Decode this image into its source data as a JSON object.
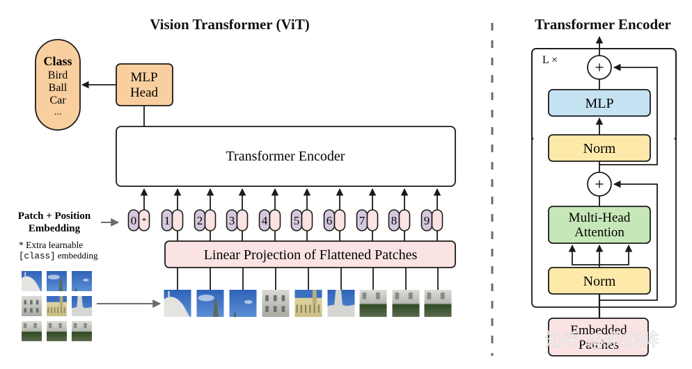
{
  "vit": {
    "title": "Vision Transformer (ViT)",
    "class_box": {
      "heading": "Class",
      "items": [
        "Bird",
        "Ball",
        "Car",
        "..."
      ]
    },
    "mlp_head": {
      "line1": "MLP",
      "line2": "Head"
    },
    "transformer_encoder_label": "Transformer Encoder",
    "patch_position_label": {
      "line1": "Patch + Position",
      "line2": "Embedding"
    },
    "extra_note": {
      "line1": "* Extra learnable",
      "line2_code": "[class]",
      "line2_rest": " embedding"
    },
    "tokens": [
      {
        "position": "0",
        "patch": "*"
      },
      {
        "position": "1",
        "patch": ""
      },
      {
        "position": "2",
        "patch": ""
      },
      {
        "position": "3",
        "patch": ""
      },
      {
        "position": "4",
        "patch": ""
      },
      {
        "position": "5",
        "patch": ""
      },
      {
        "position": "6",
        "patch": ""
      },
      {
        "position": "7",
        "patch": ""
      },
      {
        "position": "8",
        "patch": ""
      },
      {
        "position": "9",
        "patch": ""
      }
    ],
    "linear_projection_label": "Linear Projection of Flattened Patches",
    "patch_grid": {
      "rows": 3,
      "cols": 3
    },
    "patch_count": 9
  },
  "encoder_detail": {
    "title": "Transformer Encoder",
    "repeat_label": "L ×",
    "mlp_label": "MLP",
    "norm_label": "Norm",
    "attention": {
      "line1": "Multi-Head",
      "line2": "Attention"
    },
    "add_symbol": "+",
    "input_label": {
      "line1": "Embedded",
      "line2": "Patches"
    }
  },
  "watermark": "知乎 @余庆眸",
  "colors": {
    "class_fill": "#f9cf9f",
    "mlp_head_fill": "#f9cf9f",
    "position_fill": "#d6c8dc",
    "patch_fill": "#fbe3e3",
    "linear_fill": "#fbe3e3",
    "mlp_fill": "#c5e2f3",
    "norm_fill": "#fde9a9",
    "attention_fill": "#c6e7b8",
    "embedded_fill": "#fbe3e3",
    "stroke": "#1a1a1a",
    "arrow_gray": "#6b6b6b"
  }
}
